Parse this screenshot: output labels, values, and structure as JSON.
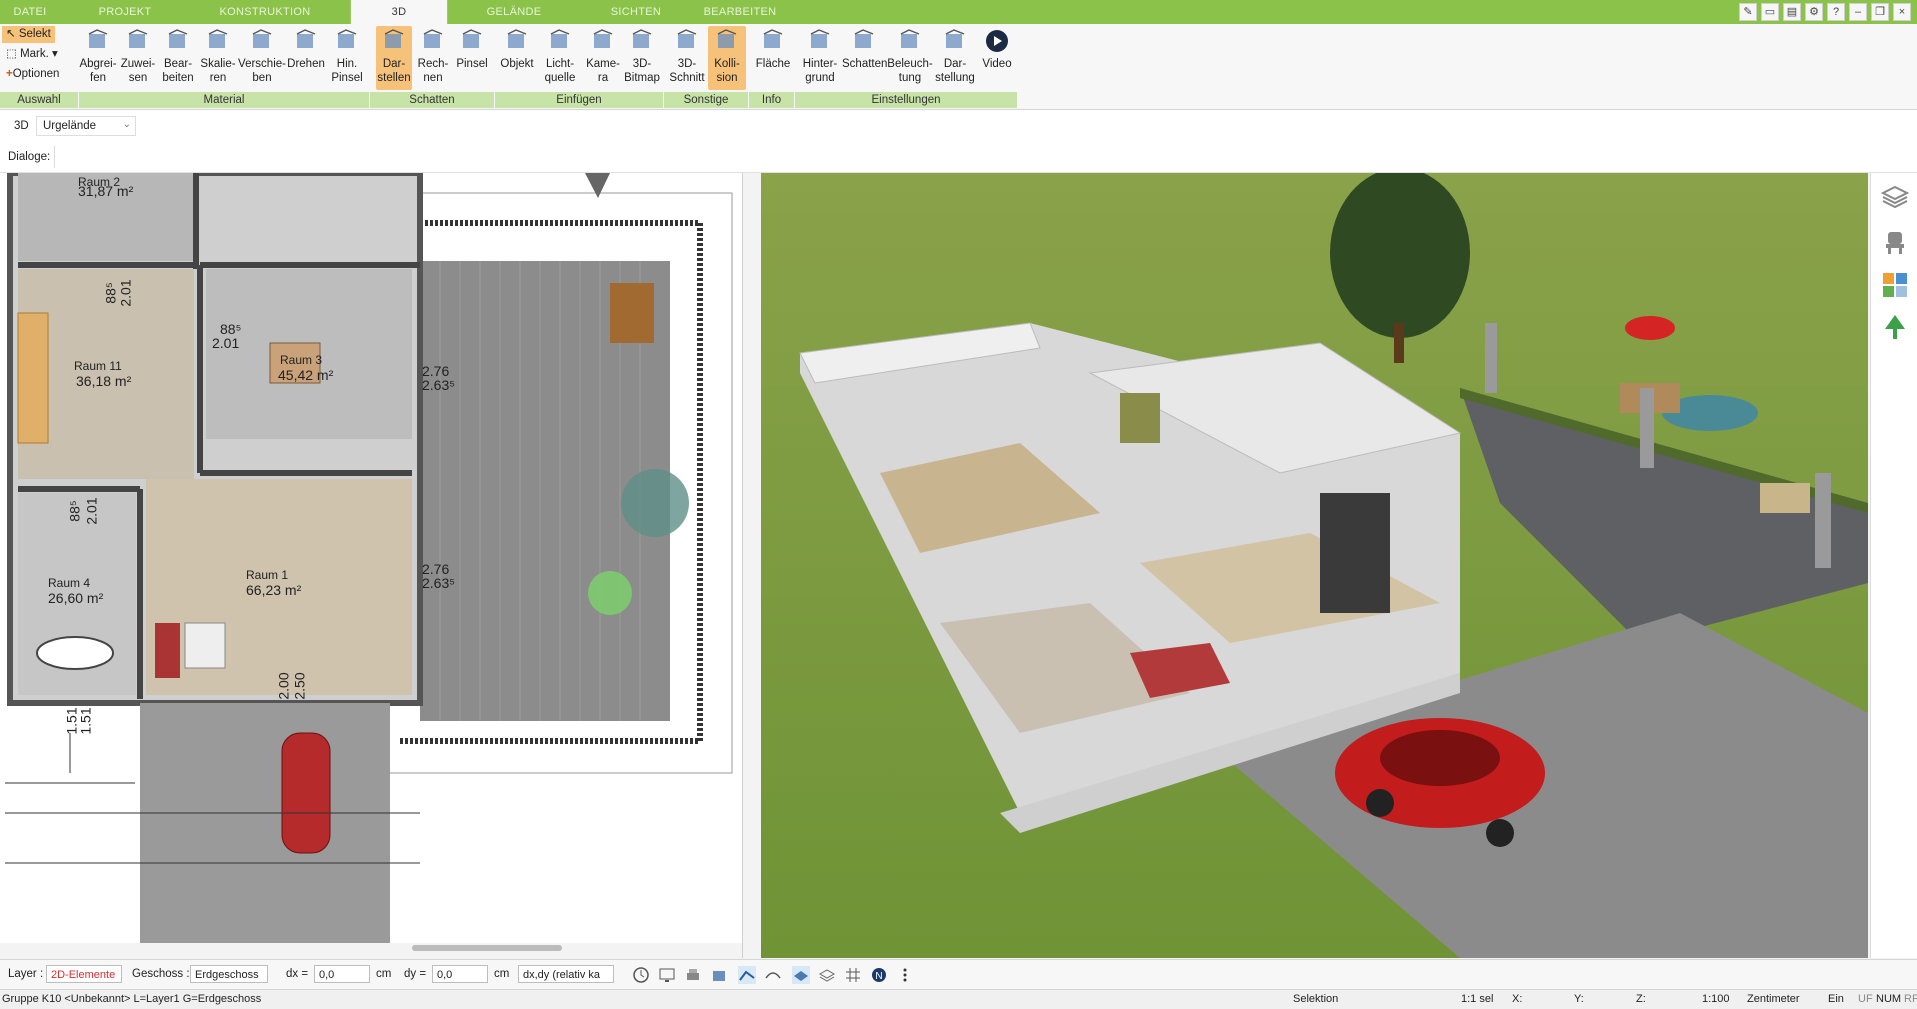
{
  "tabs": [
    "DATEI",
    "PROJEKT",
    "KONSTRUKTION",
    "3D",
    "GELÄNDE",
    "SICHTEN",
    "BEARBEITEN"
  ],
  "ribbon": {
    "left": {
      "select": "Selekt",
      "mark": "Mark.",
      "options": "Optionen"
    },
    "buttons": [
      {
        "l1": "Abgrei-",
        "l2": "fen"
      },
      {
        "l1": "Zuwei-",
        "l2": "sen"
      },
      {
        "l1": "Bear-",
        "l2": "beiten"
      },
      {
        "l1": "Skalie-",
        "l2": "ren"
      },
      {
        "l1": "Verschie-",
        "l2": "ben"
      },
      {
        "l1": "Drehen",
        "l2": ""
      },
      {
        "l1": "Hin.",
        "l2": "Pinsel"
      },
      {
        "l1": "Dar-",
        "l2": "stellen"
      },
      {
        "l1": "Rech-",
        "l2": "nen"
      },
      {
        "l1": "Pinsel",
        "l2": ""
      },
      {
        "l1": "Objekt",
        "l2": ""
      },
      {
        "l1": "Licht-",
        "l2": "quelle"
      },
      {
        "l1": "Kame-",
        "l2": "ra"
      },
      {
        "l1": "3D-",
        "l2": "Bitmap"
      },
      {
        "l1": "3D-",
        "l2": "Schnitt"
      },
      {
        "l1": "Kolli-",
        "l2": "sion"
      },
      {
        "l1": "Fläche",
        "l2": ""
      },
      {
        "l1": "Hinter-",
        "l2": "grund"
      },
      {
        "l1": "Schatten",
        "l2": ""
      },
      {
        "l1": "Beleuch-",
        "l2": "tung"
      },
      {
        "l1": "Dar-",
        "l2": "stellung"
      },
      {
        "l1": "Video",
        "l2": ""
      }
    ],
    "groups": [
      "Auswahl",
      "Material",
      "Schatten",
      "Einfügen",
      "Sonstige",
      "Info",
      "Einstellungen"
    ]
  },
  "row2": {
    "mode": "3D",
    "dropdown": "Urgelände"
  },
  "row3": {
    "label": "Dialoge:"
  },
  "plan": {
    "rooms": [
      {
        "name": "Raum 2",
        "area": "31,87 m²"
      },
      {
        "name": "Raum 11",
        "area": "36,18 m²"
      },
      {
        "name": "Raum 3",
        "area": "45,42 m²"
      },
      {
        "name": "Raum 4",
        "area": "26,60 m²"
      },
      {
        "name": "Raum 1",
        "area": "66,23 m²"
      }
    ],
    "dims": [
      "88⁵",
      "2.01",
      "88⁵",
      "2.01",
      "88⁵",
      "2.01",
      "2.76",
      "2.63⁵",
      "2.76",
      "2.63⁵",
      "2.00",
      "2.50",
      "1.51",
      "1.51"
    ]
  },
  "toolbar": {
    "layer_label": "Layer :",
    "layer_value": "2D-Elemente",
    "geschoss_label": "Geschoss :",
    "geschoss_value": "Erdgeschoss",
    "dx_label": "dx =",
    "dx_value": "0,0",
    "dx_unit": "cm",
    "dy_label": "dy =",
    "dy_value": "0,0",
    "dy_unit": "cm",
    "rel_value": "dx,dy (relativ ka"
  },
  "status": {
    "left": "Gruppe K10 <Unbekannt> L=Layer1 G=Erdgeschoss",
    "selektion": "Selektion",
    "sel": "1:1 sel",
    "x": "X:",
    "y": "Y:",
    "z": "Z:",
    "scale": "1:100",
    "unit": "Zentimeter",
    "ein": "Ein",
    "uf": "UF",
    "num": "NUM",
    "rf": "RF"
  },
  "colors": {
    "accent": "#8bc34a",
    "active": "#f6c27a",
    "group": "#c7e3a8"
  }
}
